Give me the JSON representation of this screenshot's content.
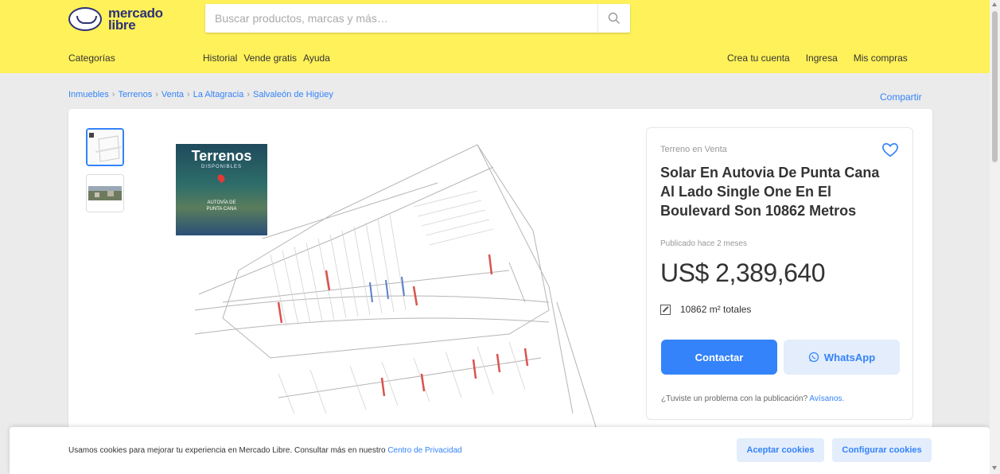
{
  "header": {
    "logo": {
      "line1": "mercado",
      "line2": "libre"
    },
    "search": {
      "placeholder": "Buscar productos, marcas y más…"
    },
    "nav_left": [
      "Categorías",
      "Historial",
      "Vende gratis",
      "Ayuda"
    ],
    "nav_right": [
      "Crea tu cuenta",
      "Ingresa",
      "Mis compras"
    ],
    "colors": {
      "brand": "#fff159",
      "logo": "#2d3277"
    }
  },
  "breadcrumb": [
    "Inmuebles",
    "Terrenos",
    "Venta",
    "La Altagracia",
    "Salvaleón de Higüey"
  ],
  "share_label": "Compartir",
  "gallery": {
    "thumbnails": [
      "plan-thumbnail",
      "aerial-photo-thumbnail"
    ],
    "promo": {
      "title": "Terrenos",
      "subtitle": "DISPONIBLES",
      "footer_line1": "AUTOVÍA DE",
      "footer_line2": "PUNTA CANA"
    }
  },
  "listing": {
    "condition": "Terreno en Venta",
    "title": "Solar En Autovia De Punta Cana Al Lado Single One En El Boulevard Son 10862 Metros",
    "published": "Publicado hace 2 meses",
    "price": "US$ 2,389,640",
    "area_value": "10862 m²",
    "area_label": "totales",
    "contact_label": "Contactar",
    "whatsapp_label": "WhatsApp",
    "problem_text": "¿Tuviste un problema con la publicación?",
    "problem_link": "Avísanos."
  },
  "cookies": {
    "text": "Usamos cookies para mejorar tu experiencia en Mercado Libre. Consultar más en nuestro",
    "link": "Centro de Privacidad",
    "accept_label": "Aceptar cookies",
    "configure_label": "Configurar cookies"
  },
  "accent_color": "#3483fa"
}
